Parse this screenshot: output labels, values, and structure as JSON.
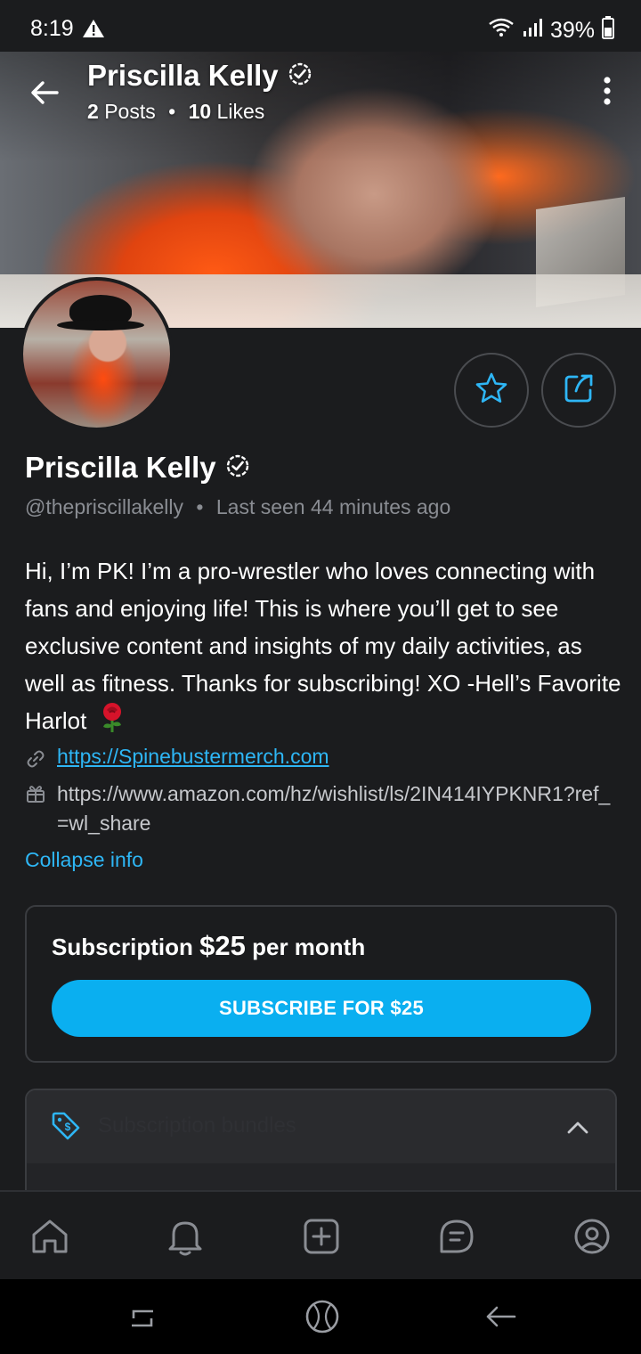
{
  "status_bar": {
    "time": "8:19",
    "battery": "39%",
    "icons": [
      "warning-icon",
      "wifi-icon",
      "signal-icon",
      "battery-icon"
    ]
  },
  "header": {
    "name": "Priscilla Kelly",
    "posts_count": "2",
    "posts_label": "Posts",
    "likes_count": "10",
    "likes_label": "Likes",
    "separator": "•"
  },
  "profile": {
    "name": "Priscilla Kelly",
    "handle": "@thepriscillakelly",
    "separator": "•",
    "last_seen": "Last seen 44 minutes ago",
    "bio": "Hi, I’m PK! I’m a pro-wrestler who loves connecting with fans and enjoying life! This is where you’ll get to see exclusive content and insights of my daily activities, as well as fitness. Thanks for subscribing! XO -Hell’s Favorite Harlot",
    "link_1": "https://Spinebustermerch.com",
    "link_2": "https://www.amazon.com/hz/wishlist/ls/2IN414IYPKNR1?ref_=wl_share",
    "collapse_label": "Collapse info"
  },
  "subscription": {
    "label": "Subscription",
    "price": "$25",
    "period": "per month",
    "button_label": "SUBSCRIBE FOR $25"
  },
  "promo": {
    "label": "Subscription bundles"
  },
  "colors": {
    "accent": "#0aaff0",
    "link": "#2eb6f5",
    "background": "#1b1c1e",
    "muted": "#8a8d93"
  }
}
